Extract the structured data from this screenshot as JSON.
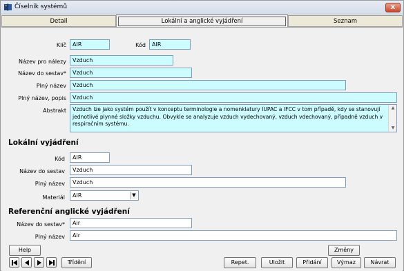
{
  "window": {
    "title": "Číselník systémů",
    "close_label": "x"
  },
  "tabs": [
    {
      "label": "Detail",
      "active": false
    },
    {
      "label": "Lokální a anglické vyjádření",
      "active": true
    },
    {
      "label": "Seznam",
      "active": false
    }
  ],
  "main": {
    "klic_label": "Klíč",
    "klic_value": "AIR",
    "kod_label": "Kód",
    "kod_value": "AIR",
    "nazev_nalezy_label": "Název pro nálezy",
    "nazev_nalezy_value": "Vzduch",
    "nazev_sestav_label": "Název do sestav*",
    "nazev_sestav_value": "Vzduch",
    "plny_nazev_label": "Plný název",
    "plny_nazev_value": "Vzduch",
    "plny_popis_label": "Plný název, popis",
    "plny_popis_value": "Vzduch",
    "abstrakt_label": "Abstrakt",
    "abstrakt_value": "Vzduch lze jako systém použít v konceptu terminologie a nomenklatury IUPAC a IFCC v tom případě, kdy se stanovují jednotlivé plynné složky vzduchu. Obvykle se analyzuje vzduch vydechovaný, vzduch vdechovaný, případně vzduch v respiračním systému."
  },
  "local": {
    "section_title": "Lokální vyjádření",
    "kod_label": "Kód",
    "kod_value": "AIR",
    "nazev_sestav_label": "Název do sestav",
    "nazev_sestav_value": "Vzduch",
    "plny_nazev_label": "Plný název",
    "plny_nazev_value": "Vzduch",
    "material_label": "Materiál",
    "material_value": "AIR"
  },
  "english": {
    "section_title": "Referenční anglické vyjádření",
    "nazev_sestav_label": "Název do sestav*",
    "nazev_sestav_value": "Air",
    "plny_nazev_label": "Plný název",
    "plny_nazev_value": "Air"
  },
  "buttons": {
    "help": "Help",
    "trideni": "Třídění",
    "zmeny": "Změny",
    "repet": "Repet.",
    "ulozit": "Uložit",
    "pridani": "Přidání",
    "vymaz": "Výmaz",
    "navrat": "Návrat"
  },
  "icons": [
    "app-book-icon",
    "close-icon",
    "first-record-icon",
    "prev-record-icon",
    "next-record-icon",
    "last-record-icon",
    "dropdown-arrow-icon",
    "scroll-up-icon",
    "scroll-down-icon"
  ]
}
